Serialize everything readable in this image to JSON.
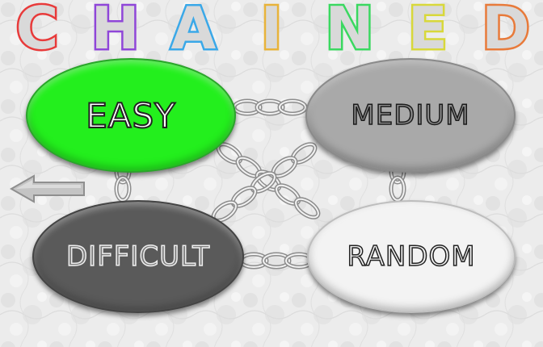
{
  "title": "CHAINED",
  "title_colors": [
    "#e83a3a",
    "#8f46d8",
    "#3aa8e8",
    "#e8b33a",
    "#3ad860",
    "#d8d83a",
    "#e87a3a"
  ],
  "menu": {
    "easy_label": "EASY",
    "medium_label": "MEDIUM",
    "difficult_label": "DIFFICULT",
    "random_label": "RANDOM"
  },
  "colors": {
    "easy": "#23ef1d",
    "medium": "#a9a9a9",
    "difficult": "#5a5a5a",
    "random": "#f3f3f3"
  },
  "icons": {
    "back": "left-arrow-icon",
    "links": "chain-icon"
  }
}
